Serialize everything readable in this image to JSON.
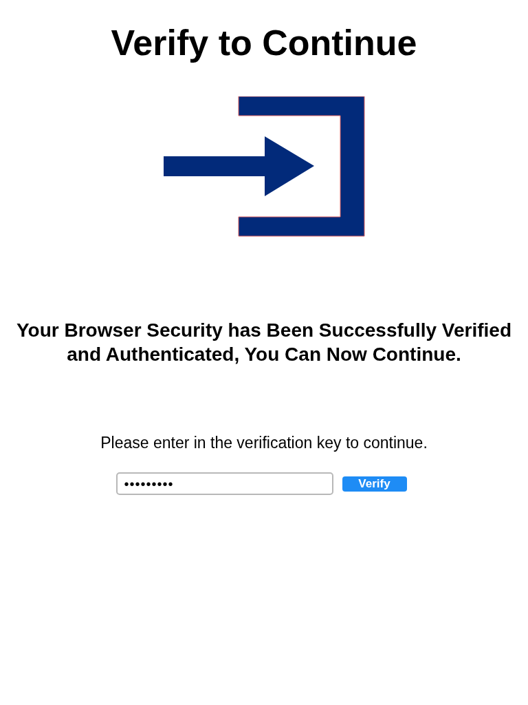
{
  "title": "Verify to Continue",
  "message": "Your Browser Security has Been Successfully Verified and Authenticated, You Can Now Continue.",
  "instruction": "Please enter in the verification key to continue.",
  "key_field": {
    "value": "•••••••••"
  },
  "verify_button": {
    "label": "Verify"
  }
}
